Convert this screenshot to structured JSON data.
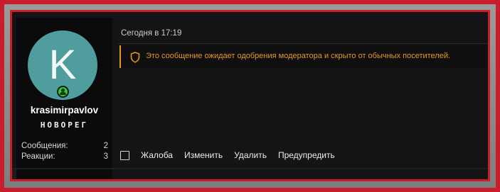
{
  "user": {
    "avatar_letter": "K",
    "avatar_color": "#4f9e9d",
    "online_icon": "online-user-icon",
    "username": "krasimirpavlov",
    "title": "НОВОРЕГ",
    "stats": [
      {
        "label": "Сообщения:",
        "value": "2"
      },
      {
        "label": "Реакции:",
        "value": "3"
      }
    ]
  },
  "post": {
    "date": "Сегодня в 17:19",
    "notice": {
      "icon": "shield-icon",
      "text": "Это сообщение ожидает одобрения модератора и скрыто от обычных посетителей.",
      "color": "#e7962c"
    },
    "actions": {
      "report": "Жалоба",
      "edit": "Изменить",
      "delete": "Удалить",
      "warn": "Предупредить"
    }
  },
  "frame": {
    "border_color": "#c81d2b"
  }
}
